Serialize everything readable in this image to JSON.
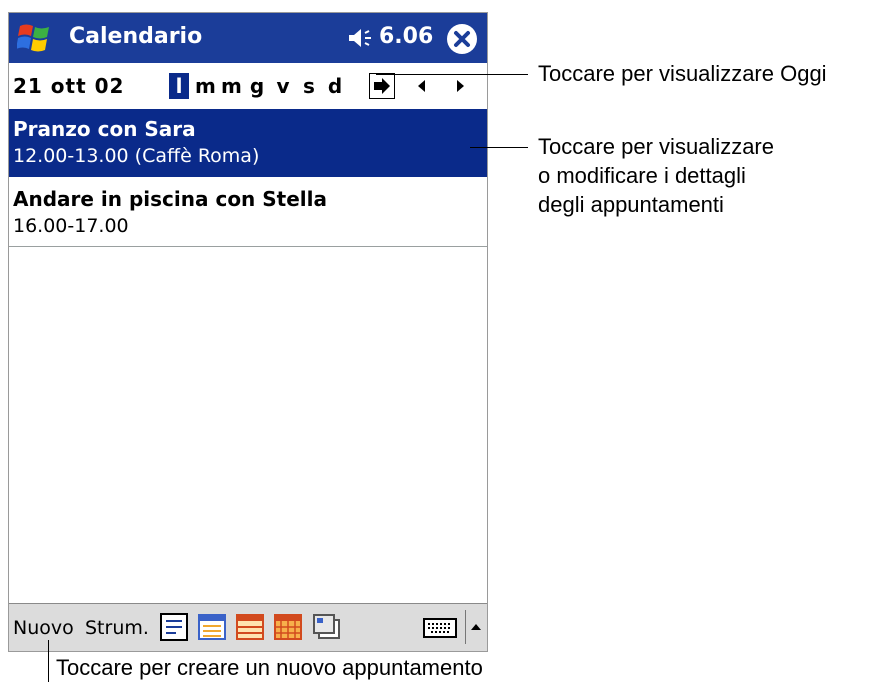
{
  "titlebar": {
    "app_title": "Calendario",
    "time": "6.06",
    "color": "#1b3d99"
  },
  "datebar": {
    "date": "21 ott 02",
    "days": [
      "l",
      "m",
      "m",
      "g",
      "v",
      "s",
      "d"
    ],
    "selected_day_index": 0
  },
  "appointments": [
    {
      "title": "Pranzo con Sara",
      "time": "12.00-13.00 (Caffè Roma)",
      "selected": true
    },
    {
      "title": "Andare in piscina con Stella",
      "time": "16.00-17.00",
      "selected": false
    }
  ],
  "menubar": {
    "new_label": "Nuovo",
    "tools_label": "Strum.",
    "view_icons": [
      "agenda-view-icon",
      "day-view-icon",
      "week-view-icon",
      "month-view-icon",
      "year-view-icon"
    ]
  },
  "callouts": {
    "today": "Toccare per visualizzare Oggi",
    "details_line1": "Toccare per visualizzare",
    "details_line2": "o modificare i dettagli",
    "details_line3": "degli appuntamenti",
    "new_appt": "Toccare per creare un nuovo appuntamento"
  },
  "colors": {
    "selection": "#0a2a8a",
    "menubar": "#dcdcdc"
  }
}
